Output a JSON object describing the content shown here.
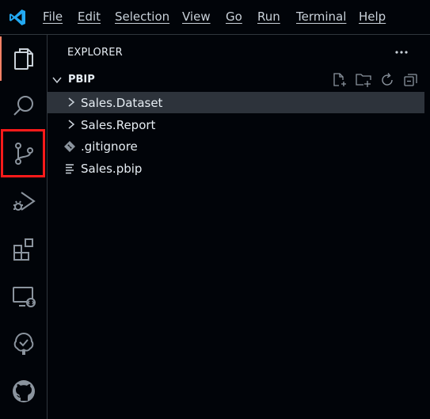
{
  "menu": {
    "items": [
      "File",
      "Edit",
      "Selection",
      "View",
      "Go",
      "Run",
      "Terminal",
      "Help"
    ]
  },
  "activity_bar": {
    "items": [
      {
        "icon": "files-icon",
        "active": true
      },
      {
        "icon": "search-icon"
      },
      {
        "icon": "source-control-icon",
        "highlighted": true
      },
      {
        "icon": "run-debug-icon"
      },
      {
        "icon": "extensions-icon"
      },
      {
        "icon": "remote-explorer-icon"
      },
      {
        "icon": "testing-icon"
      },
      {
        "icon": "github-icon"
      }
    ],
    "highlight_color": "#ff1a1a",
    "active_indicator_color": "#f78166"
  },
  "sidebar": {
    "title": "EXPLORER",
    "folder": {
      "name": "PBIP",
      "actions": [
        "new-file-icon",
        "new-folder-icon",
        "refresh-icon",
        "collapse-all-icon"
      ]
    },
    "tree": [
      {
        "label": "Sales.Dataset",
        "kind": "folder",
        "selected": true
      },
      {
        "label": "Sales.Report",
        "kind": "folder"
      },
      {
        "label": ".gitignore",
        "kind": "git-file"
      },
      {
        "label": "Sales.pbip",
        "kind": "text-file"
      }
    ]
  },
  "colors": {
    "background": "#010409",
    "selected_row": "#2d333b",
    "text": "#e6edf3",
    "icon": "#8b949e",
    "vscode_blue": "#23a9f2"
  }
}
